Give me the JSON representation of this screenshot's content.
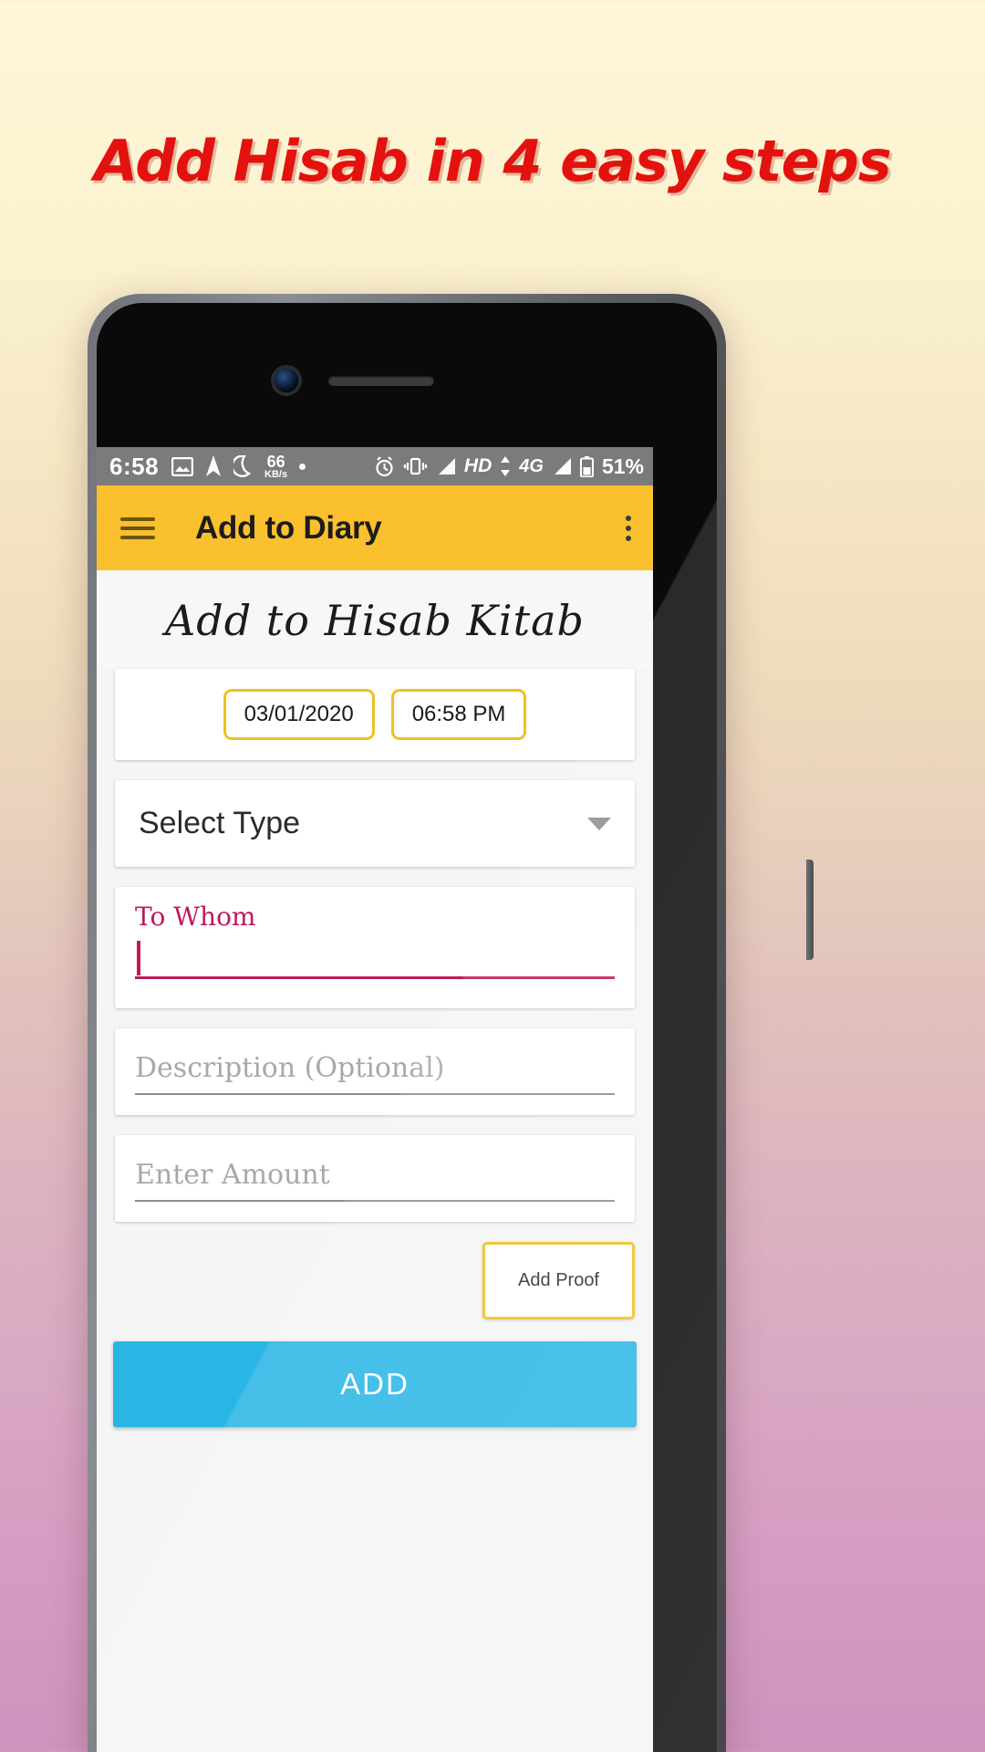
{
  "promo": {
    "headline": "Add Hisab in 4 easy steps",
    "accent_color": "#e3120f",
    "background_top": "#fdf6d8",
    "background_bottom": "#cf93bd"
  },
  "statusbar": {
    "time": "6:58",
    "icons_left": [
      "image-icon",
      "navigation-icon",
      "moon-icon"
    ],
    "network_speed_value": "66",
    "network_speed_unit": "KB/s",
    "icons_right": [
      "alarm-icon",
      "vibrate-icon",
      "signal-icon"
    ],
    "hd_label": "HD",
    "network_type": "4G",
    "battery_percent": "51%"
  },
  "appbar": {
    "menu_icon": "hamburger-icon",
    "title": "Add to Diary",
    "overflow_icon": "kebab-menu-icon",
    "background_color": "#fbc02d"
  },
  "screen": {
    "heading": "Add to Hisab Kitab",
    "date_value": "03/01/2020",
    "time_value": "06:58 PM",
    "select_type_label": "Select Type",
    "select_caret_icon": "chevron-down-icon",
    "to_whom_label": "To Whom",
    "to_whom_value": "",
    "description_placeholder": "Description (Optional)",
    "amount_placeholder": "Enter Amount",
    "add_proof_label": "Add Proof",
    "add_button_label": "ADD",
    "accent_amber": "#f0c020",
    "accent_pink": "#c2185b",
    "add_button_color": "#29b6e5"
  }
}
